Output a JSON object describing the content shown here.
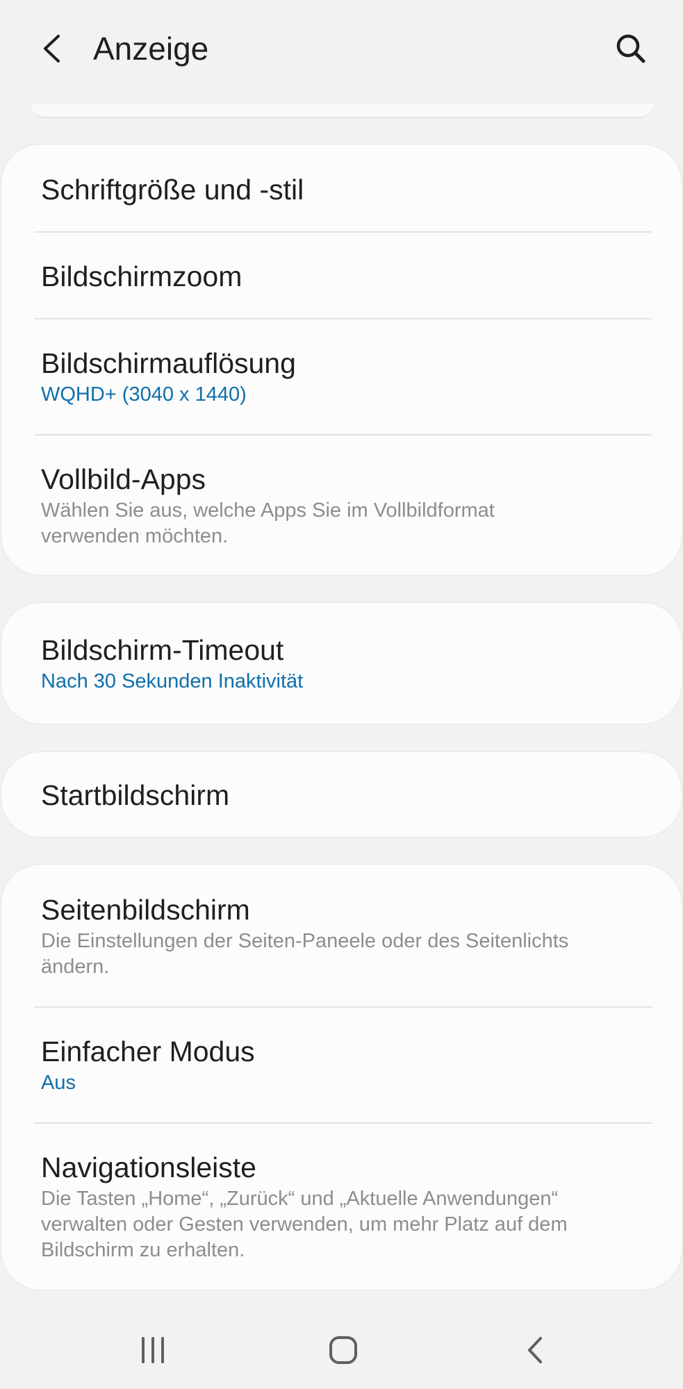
{
  "header": {
    "title": "Anzeige",
    "back_icon": "back-arrow-icon",
    "search_icon": "search-icon"
  },
  "cards": [
    {
      "items": [
        {
          "title": "Schriftgröße und -stil"
        },
        {
          "title": "Bildschirmzoom"
        },
        {
          "title": "Bildschirmauflösung",
          "subtitle": "WQHD+ (3040 x 1440)"
        },
        {
          "title": "Vollbild-Apps",
          "subtitle": "Wählen Sie aus, welche Apps Sie im Vollbildformat verwenden möchten."
        }
      ]
    },
    {
      "items": [
        {
          "title": "Bildschirm-Timeout",
          "subtitle": "Nach 30 Sekunden Inaktivität"
        }
      ]
    },
    {
      "items": [
        {
          "title": "Startbildschirm"
        }
      ]
    },
    {
      "items": [
        {
          "title": "Seitenbildschirm",
          "subtitle": "Die Einstellungen der Seiten-Paneele oder des Seitenlichts ändern."
        },
        {
          "title": "Einfacher Modus",
          "subtitle": "Aus"
        },
        {
          "title": "Navigationsleiste",
          "subtitle": "Die Tasten „Home“, „Zurück“ und „Aktuelle Anwendungen“ verwalten oder Gesten verwenden, um mehr Platz auf dem Bildschirm zu erhalten."
        }
      ]
    }
  ],
  "navbar": {
    "recents_icon": "recent-apps-icon",
    "home_icon": "home-icon",
    "back_icon": "back-icon"
  },
  "colors": {
    "background": "#f2f2f2",
    "card": "#fcfcfc",
    "accent_subtitle": "#0f6fab",
    "secondary_text": "#8d8d8d"
  }
}
